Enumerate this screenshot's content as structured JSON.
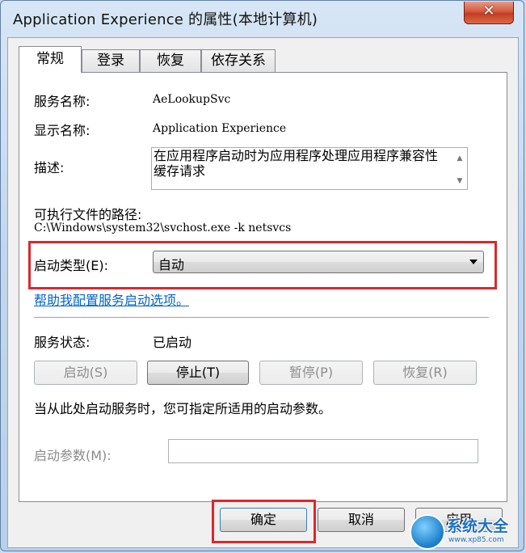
{
  "window": {
    "title": "Application Experience 的属性(本地计算机)",
    "close_glyph": "✕"
  },
  "tabs": [
    {
      "label": "常规",
      "active": true
    },
    {
      "label": "登录",
      "active": false
    },
    {
      "label": "恢复",
      "active": false
    },
    {
      "label": "依存关系",
      "active": false
    }
  ],
  "general": {
    "service_name_label": "服务名称:",
    "service_name_value": "AeLookupSvc",
    "display_name_label": "显示名称:",
    "display_name_value": "Application Experience",
    "description_label": "描述:",
    "description_value": "在应用程序启动时为应用程序处理应用程序兼容性缓存请求",
    "path_label": "可执行文件的路径:",
    "path_value": "C:\\Windows\\system32\\svchost.exe -k netsvcs",
    "startup_type_label": "启动类型(E):",
    "startup_type_value": "自动",
    "help_link": "帮助我配置服务启动选项。",
    "status_label": "服务状态:",
    "status_value": "已启动",
    "start_button": "启动(S)",
    "stop_button": "停止(T)",
    "pause_button": "暂停(P)",
    "resume_button": "恢复(R)",
    "hint_text": "当从此处启动服务时，您可指定所适用的启动参数。",
    "start_params_label": "启动参数(M):",
    "start_params_value": ""
  },
  "dialog_buttons": {
    "ok": "确定",
    "cancel": "取消",
    "apply": "应用"
  },
  "watermark": {
    "text": "系统大全",
    "sub": "www.xp85.com"
  },
  "colors": {
    "highlight": "#e0262a",
    "link": "#0066cc",
    "title_close": "#c23d21"
  }
}
